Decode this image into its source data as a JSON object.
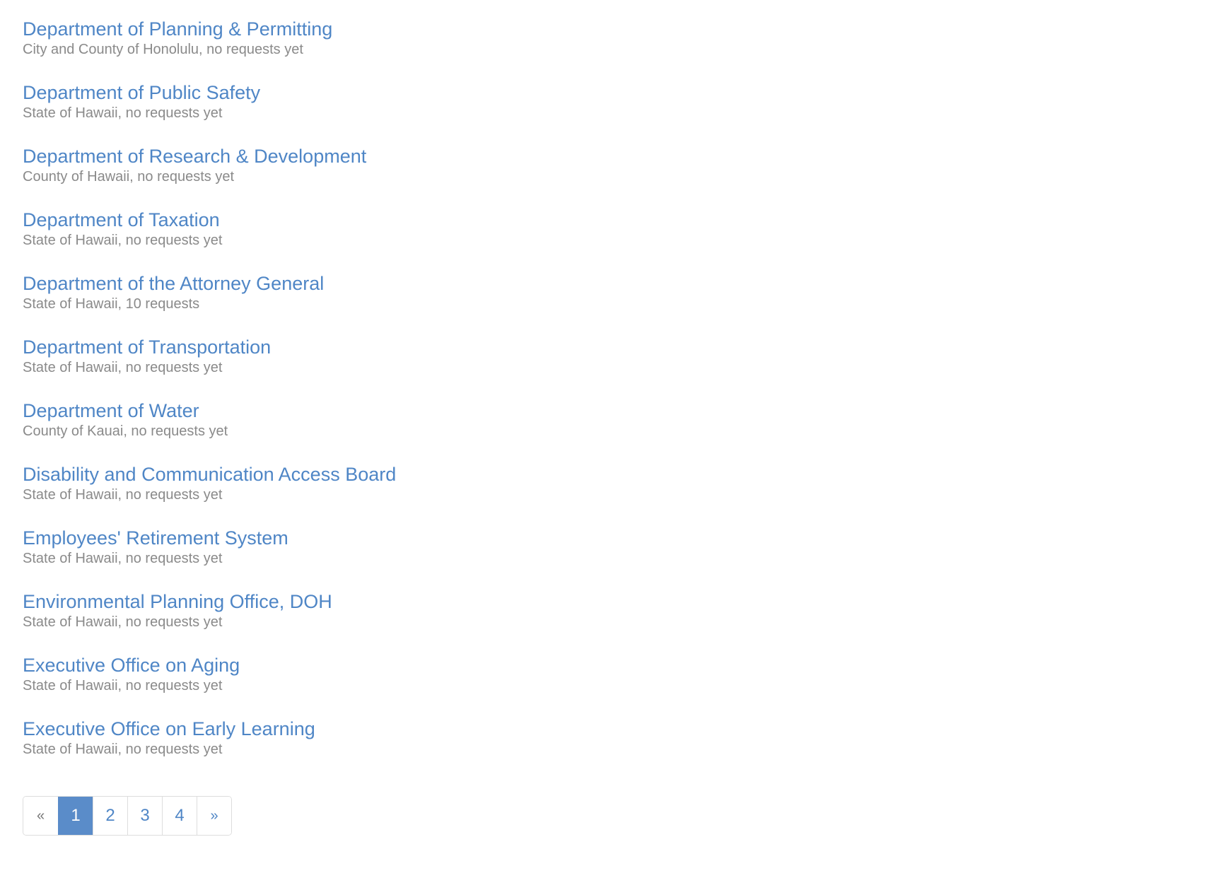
{
  "agencies": [
    {
      "name": "Department of Planning & Permitting",
      "meta": "City and County of Honolulu, no requests yet"
    },
    {
      "name": "Department of Public Safety",
      "meta": "State of Hawaii, no requests yet"
    },
    {
      "name": "Department of Research & Development",
      "meta": "County of Hawaii, no requests yet"
    },
    {
      "name": "Department of Taxation",
      "meta": "State of Hawaii, no requests yet"
    },
    {
      "name": "Department of the Attorney General",
      "meta": "State of Hawaii, 10 requests"
    },
    {
      "name": "Department of Transportation",
      "meta": "State of Hawaii, no requests yet"
    },
    {
      "name": "Department of Water",
      "meta": "County of Kauai, no requests yet"
    },
    {
      "name": "Disability and Communication Access Board",
      "meta": "State of Hawaii, no requests yet"
    },
    {
      "name": "Employees' Retirement System",
      "meta": "State of Hawaii, no requests yet"
    },
    {
      "name": "Environmental Planning Office, DOH",
      "meta": "State of Hawaii, no requests yet"
    },
    {
      "name": "Executive Office on Aging",
      "meta": "State of Hawaii, no requests yet"
    },
    {
      "name": "Executive Office on Early Learning",
      "meta": "State of Hawaii, no requests yet"
    }
  ],
  "pagination": {
    "prev": "«",
    "pages": [
      "1",
      "2",
      "3",
      "4"
    ],
    "current": "1",
    "next": "»"
  },
  "colors": {
    "link": "#4f86c6",
    "meta": "#8a8a8a",
    "active_page_bg": "#5a8cc9"
  }
}
